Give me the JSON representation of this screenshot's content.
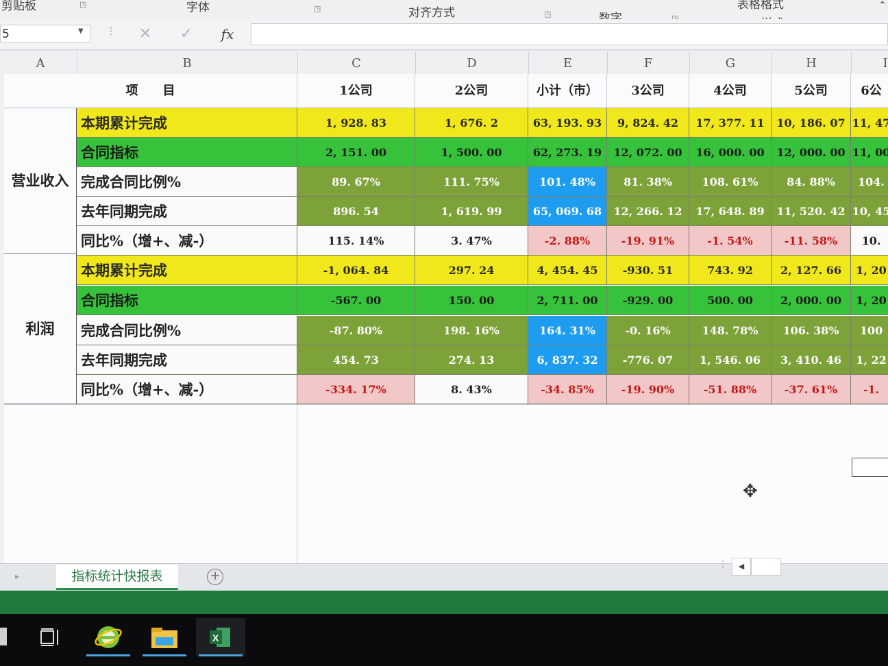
{
  "ribbon": {
    "groups": [
      "剪贴板",
      "字体",
      "对齐方式",
      "数字",
      "表格格式",
      "样式"
    ]
  },
  "formula_bar": {
    "name_box": "5",
    "fx_label": "fx",
    "value": ""
  },
  "columns": [
    "A",
    "B",
    "C",
    "D",
    "E",
    "F",
    "G",
    "H",
    "I"
  ],
  "table": {
    "header": {
      "item_label": "项　　目",
      "companies": [
        "1公司",
        "2公司",
        "小计（市）",
        "3公司",
        "4公司",
        "5公司",
        "6公"
      ]
    },
    "sections": [
      {
        "title": "营业收入",
        "rows": [
          {
            "label": "本期累计完成",
            "values": [
              "1, 928. 83",
              "1, 676. 2",
              "63, 193. 93",
              "9, 824. 42",
              "17, 377. 11",
              "10, 186. 07",
              "11, 47"
            ]
          },
          {
            "label": "合同指标",
            "values": [
              "2, 151. 00",
              "1, 500. 00",
              "62, 273. 19",
              "12, 072. 00",
              "16, 000. 00",
              "12, 000. 00",
              "11, 00"
            ]
          },
          {
            "label": "完成合同比例%",
            "values": [
              "89. 67%",
              "111. 75%",
              "101. 48%",
              "81. 38%",
              "108. 61%",
              "84. 88%",
              "104."
            ]
          },
          {
            "label": "去年同期完成",
            "values": [
              "896. 54",
              "1, 619. 99",
              "65, 069. 68",
              "12, 266. 12",
              "17, 648. 89",
              "11, 520. 42",
              "10, 45"
            ]
          },
          {
            "label": "同比%（增+、减-）",
            "values": [
              "115. 14%",
              "3. 47%",
              "-2. 88%",
              "-19. 91%",
              "-1. 54%",
              "-11. 58%",
              "10."
            ]
          }
        ]
      },
      {
        "title": "利润",
        "rows": [
          {
            "label": "本期累计完成",
            "values": [
              "-1, 064. 84",
              "297. 24",
              "4, 454. 45",
              "-930. 51",
              "743. 92",
              "2, 127. 66",
              "1, 20"
            ]
          },
          {
            "label": "合同指标",
            "values": [
              "-567. 00",
              "150. 00",
              "2, 711. 00",
              "-929. 00",
              "500. 00",
              "2, 000. 00",
              "1, 20"
            ]
          },
          {
            "label": "完成合同比例%",
            "values": [
              "-87. 80%",
              "198. 16%",
              "164. 31%",
              "-0. 16%",
              "148. 78%",
              "106. 38%",
              "100"
            ]
          },
          {
            "label": "去年同期完成",
            "values": [
              "454. 73",
              "274. 13",
              "6, 837. 32",
              "-776. 07",
              "1, 546. 06",
              "3, 410. 46",
              "1, 22"
            ]
          },
          {
            "label": "同比%（增+、减-）",
            "values": [
              "-334. 17%",
              "8. 43%",
              "-34. 85%",
              "-19. 90%",
              "-51. 88%",
              "-37. 61%",
              "-1."
            ]
          }
        ]
      }
    ]
  },
  "colors": {
    "yellow": "#f0e81a",
    "green": "#36c23a",
    "olive": "#7ea23a",
    "blue": "#1e9df0",
    "pink": "#f2c7c7",
    "negative_text": "#c41818",
    "excel_green": "#1f7a3d"
  },
  "sheet_tabs": {
    "active": "指标统计快报表",
    "add_icon": "plus-circle-icon"
  },
  "taskbar": {
    "items": [
      "start-icon",
      "task-view-icon",
      "ie-browser-icon",
      "file-explorer-icon",
      "excel-icon"
    ]
  }
}
